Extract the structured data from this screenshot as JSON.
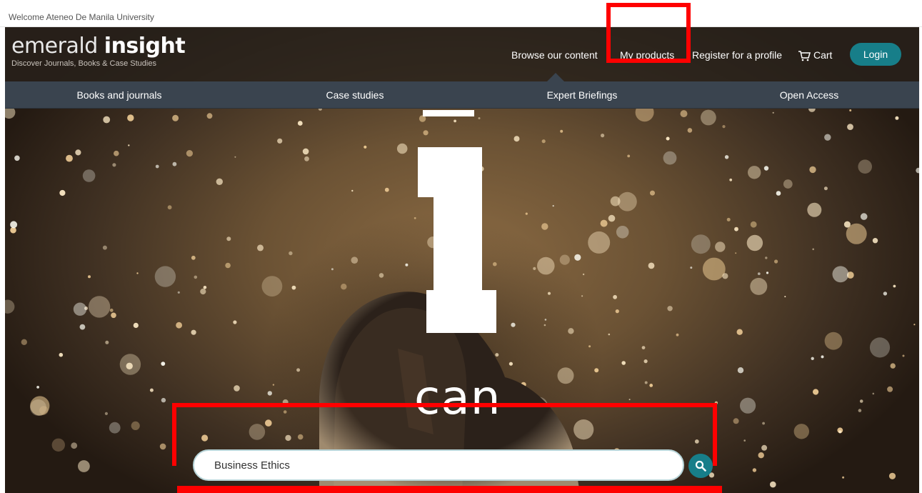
{
  "welcome": {
    "text": "Welcome Ateneo De Manila University"
  },
  "logo": {
    "light": "emerald ",
    "bold": "insight",
    "tagline": "Discover Journals, Books & Case Studies"
  },
  "topnav": {
    "browse": "Browse our content",
    "products": "My products",
    "register": "Register for a profile",
    "cart": "Cart",
    "login": "Login"
  },
  "categories": {
    "books": "Books and journals",
    "cases": "Case studies",
    "briefings": "Expert Briefings",
    "open": "Open Access"
  },
  "hero": {
    "word": "can"
  },
  "search": {
    "value": "Business Ethics",
    "button_icon": "search-icon"
  },
  "colors": {
    "accent": "#177e89",
    "highlight": "#ff0000",
    "catbar": "#3a444f"
  }
}
